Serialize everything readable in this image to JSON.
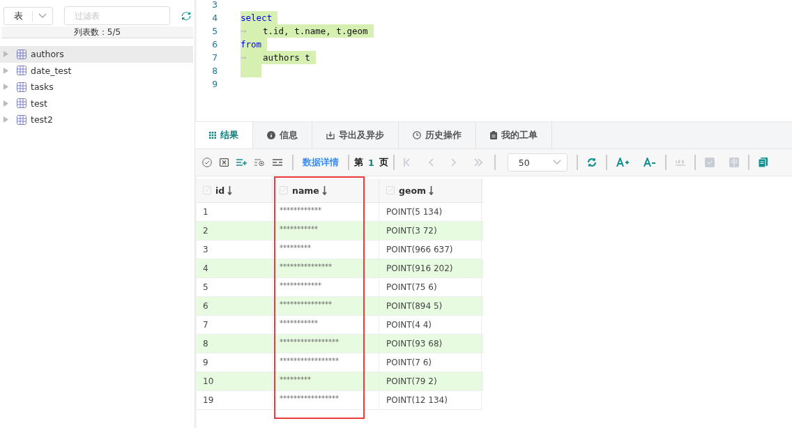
{
  "sidebar": {
    "type_select": {
      "value": "表"
    },
    "filter": {
      "placeholder": "过滤表"
    },
    "count_label": "列表数：5/5",
    "tables": [
      {
        "name": "authors",
        "selected": true
      },
      {
        "name": "date_test",
        "selected": false
      },
      {
        "name": "tasks",
        "selected": false
      },
      {
        "name": "test",
        "selected": false
      },
      {
        "name": "test2",
        "selected": false
      }
    ]
  },
  "editor": {
    "lines": [
      {
        "number": "3",
        "selected": false
      },
      {
        "number": "4",
        "code": "select",
        "kind": "keyword",
        "selected": true
      },
      {
        "number": "5",
        "code": "t.id, t.name, t.geom",
        "kind": "indented",
        "selected": true
      },
      {
        "number": "6",
        "code": "from",
        "kind": "keyword",
        "selected": true
      },
      {
        "number": "7",
        "code": "authors t",
        "kind": "indented",
        "selected": true
      },
      {
        "number": "8",
        "selected": true
      },
      {
        "number": "9",
        "selected": false
      }
    ]
  },
  "tabs": [
    {
      "label": "结果",
      "kind": "grid",
      "selected": true
    },
    {
      "label": "信息",
      "kind": "info",
      "selected": false
    },
    {
      "label": "导出及异步",
      "kind": "export",
      "selected": false
    },
    {
      "label": "历史操作",
      "kind": "clock",
      "selected": false
    },
    {
      "label": "我的工单",
      "kind": "clipboard",
      "selected": false
    }
  ],
  "toolbar": {
    "data_detail_link": "数据详情",
    "page_prefix": "第",
    "page_number": "1",
    "page_suffix": "页",
    "page_size": "50"
  },
  "table": {
    "columns": [
      {
        "title": "id",
        "highlighted": false
      },
      {
        "title": "name",
        "highlighted": true
      },
      {
        "title": "geom",
        "highlighted": false
      }
    ],
    "rows": [
      [
        "1",
        "************",
        "POINT(5 134)"
      ],
      [
        "2",
        "***********",
        "POINT(3 72)"
      ],
      [
        "3",
        "*********",
        "POINT(966 637)"
      ],
      [
        "4",
        "***************",
        "POINT(916 202)"
      ],
      [
        "5",
        "************",
        "POINT(75 6)"
      ],
      [
        "6",
        "***************",
        "POINT(894 5)"
      ],
      [
        "7",
        "***********",
        "POINT(4 4)"
      ],
      [
        "8",
        "*****************",
        "POINT(93 68)"
      ],
      [
        "9",
        "*****************",
        "POINT(7 6)"
      ],
      [
        "10",
        "*********",
        "POINT(79 2)"
      ],
      [
        "19",
        "*****************",
        "POINT(12 134)"
      ]
    ]
  }
}
